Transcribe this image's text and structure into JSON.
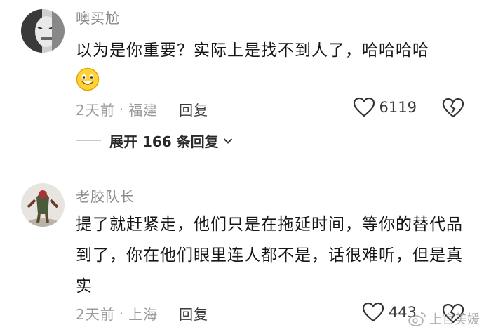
{
  "comments": [
    {
      "username": "噢买尬",
      "text": "以为是你重要？实际上是找不到人了，哈哈哈哈",
      "emoji": "smiling-face-emoji",
      "time": "2天前",
      "separator": "·",
      "location": "福建",
      "reply_label": "回复",
      "likes": "6119",
      "expand_label": "展开 166 条回复"
    },
    {
      "username": "老胶队长",
      "text": "提了就赶紧走，他们只是在拖延时间，等你的替代品到了，你在他们眼里连人都不是，话很难听，但是真实",
      "time": "2天前",
      "separator": "·",
      "location": "上海",
      "reply_label": "回复",
      "likes": "443"
    }
  ],
  "watermark": "上官美媛",
  "colors": {
    "meta": "#9a9a9a",
    "text": "#161616",
    "username": "#8a8a8a"
  }
}
